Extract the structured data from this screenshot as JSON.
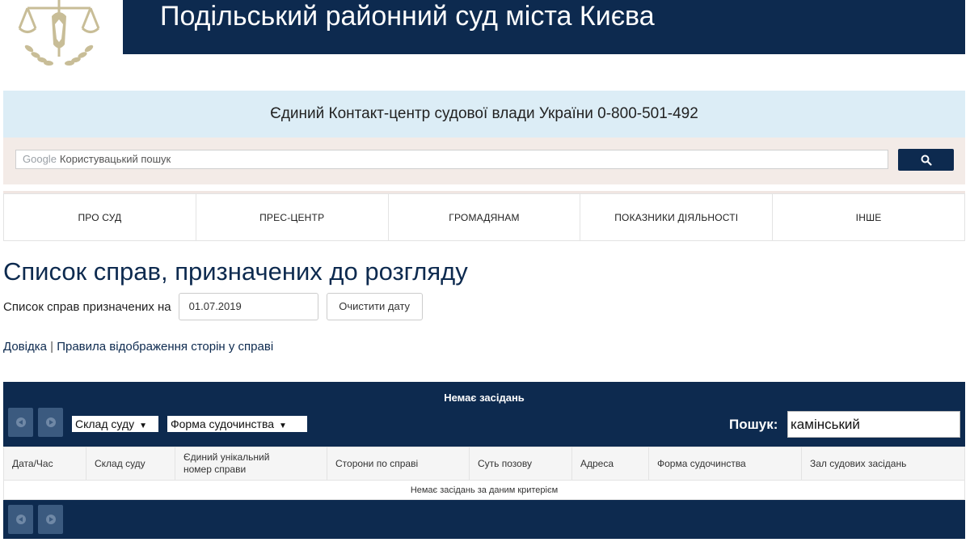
{
  "header": {
    "court_name": "Подільський районний суд міста Києва"
  },
  "contact_center": {
    "text": "Єдиний Контакт-центр судової влади України 0-800-501-492"
  },
  "search": {
    "google_label": "Google",
    "placeholder": "Користувацький пошук"
  },
  "nav": {
    "items": [
      {
        "label": "ПРО СУД"
      },
      {
        "label": "ПРЕС-ЦЕНТР"
      },
      {
        "label": "ГРОМАДЯНАМ"
      },
      {
        "label": "ПОКАЗНИКИ ДІЯЛЬНОСТІ"
      },
      {
        "label": "ІНШЕ"
      }
    ]
  },
  "page": {
    "title": "Список справ, призначених до розгляду",
    "date_label": "Список справ призначених на",
    "date_value": "01.07.2019",
    "clear_button": "Очистити дату",
    "help_link": "Довідка",
    "separator": "|",
    "rules_link": "Правила відображення сторін у справі"
  },
  "table": {
    "status_title": "Немає засідань",
    "filter_court": "Склад суду",
    "filter_form": "Форма судочинства",
    "search_label": "Пошук:",
    "search_value": "камінський",
    "columns": [
      "Дата/Час",
      "Склад суду",
      "Єдиний унікальний номер справи",
      "Сторони по справі",
      "Суть позову",
      "Адреса",
      "Форма судочинства",
      "Зал судових засідань"
    ],
    "empty_message": "Немає засідань за даним критерієм"
  },
  "colors": {
    "primary": "#0d2a4f",
    "contact_bg": "#dcedf6",
    "search_bg": "#f3ebe7",
    "logo_gold": "#c8bd97"
  }
}
